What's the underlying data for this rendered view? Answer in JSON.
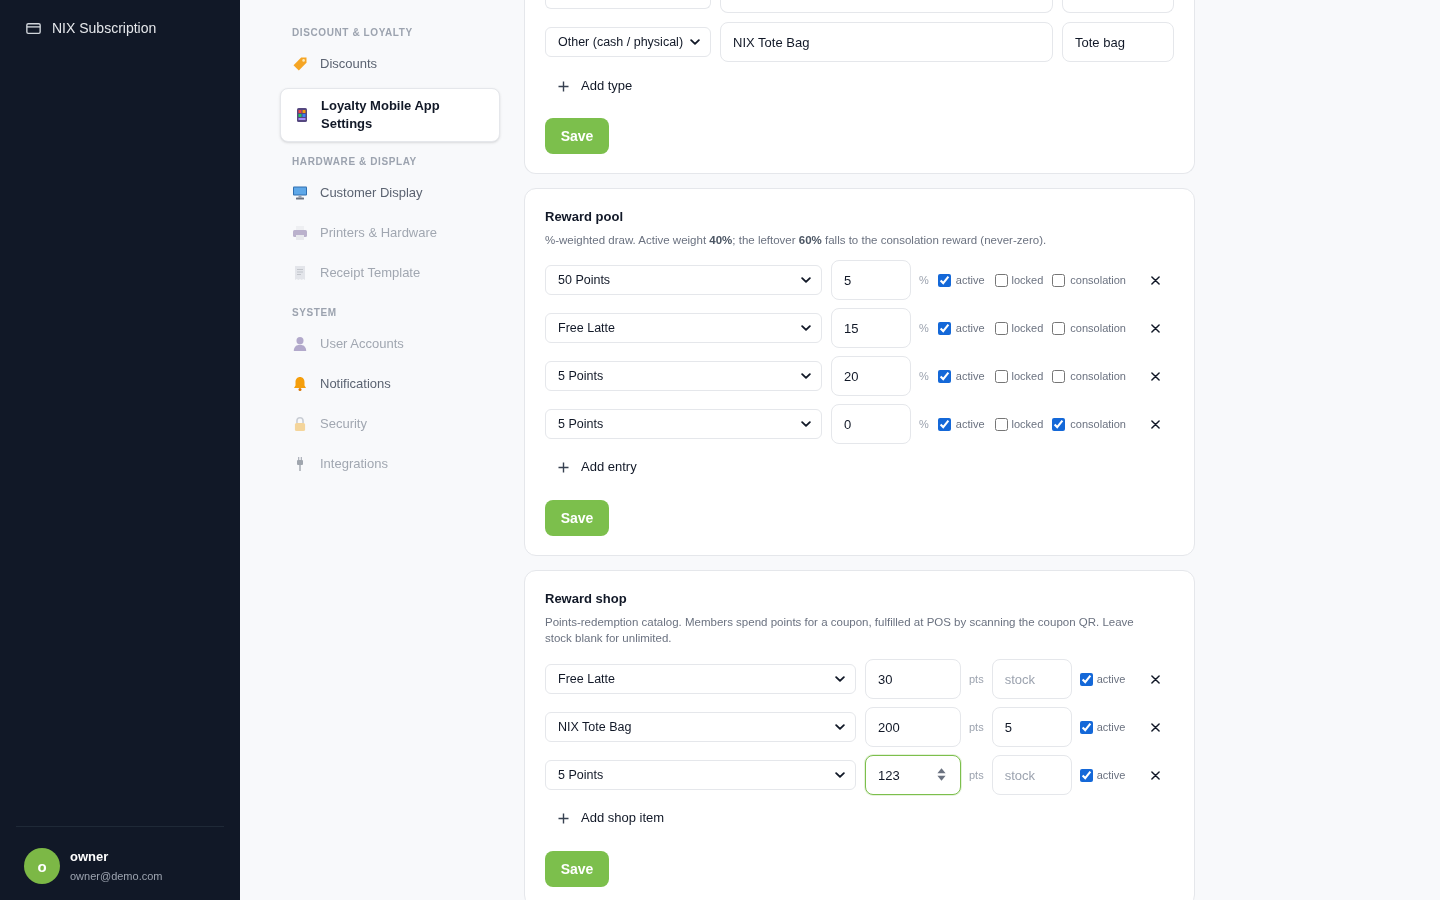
{
  "sidebar": {
    "subscription_link": {
      "label": "NIX Subscription"
    },
    "user": {
      "initial": "o",
      "name": "owner",
      "email": "owner@demo.com"
    }
  },
  "settings_nav": [
    {
      "heading": "DISCOUNT & LOYALTY",
      "items": [
        {
          "label": "Discounts",
          "selected": false,
          "disabled": false
        },
        {
          "label": "Loyalty Mobile App Settings",
          "selected": true,
          "disabled": false
        }
      ]
    },
    {
      "heading": "HARDWARE & DISPLAY",
      "items": [
        {
          "label": "Customer Display",
          "selected": false,
          "disabled": false
        },
        {
          "label": "Printers & Hardware",
          "selected": false,
          "disabled": true
        },
        {
          "label": "Receipt Template",
          "selected": false,
          "disabled": true
        }
      ]
    },
    {
      "heading": "SYSTEM",
      "items": [
        {
          "label": "User Accounts",
          "selected": false,
          "disabled": true
        },
        {
          "label": "Notifications",
          "selected": false,
          "disabled": false
        },
        {
          "label": "Security",
          "selected": false,
          "disabled": true
        },
        {
          "label": "Integrations",
          "selected": false,
          "disabled": true
        }
      ]
    }
  ],
  "reward_types": {
    "rows": [
      {
        "cut_off": true
      },
      {
        "cut_off": false,
        "type": "Other (cash / physical)",
        "name": "NIX Tote Bag",
        "label": "Tote bag"
      }
    ],
    "add_button": "Add type",
    "save_button": "Save"
  },
  "reward_pool": {
    "title": "Reward pool",
    "description": "%-weighted draw. Active weight **40%**; the leftover **60%** falls to the consolation reward (never-zero).",
    "entries": [
      {
        "reward": "50 Points",
        "weight": "5",
        "unit": "%",
        "active": true,
        "active_label": "active",
        "locked": false,
        "locked_label": "locked",
        "consolation": false,
        "consolation_label": "consolation"
      },
      {
        "reward": "Free Latte",
        "weight": "15",
        "unit": "%",
        "active": true,
        "active_label": "active",
        "locked": false,
        "locked_label": "locked",
        "consolation": false,
        "consolation_label": "consolation"
      },
      {
        "reward": "5 Points",
        "weight": "20",
        "unit": "%",
        "active": true,
        "active_label": "active",
        "locked": false,
        "locked_label": "locked",
        "consolation": false,
        "consolation_label": "consolation"
      },
      {
        "reward": "5 Points",
        "weight": "0",
        "unit": "%",
        "active": true,
        "active_label": "active",
        "locked": false,
        "locked_label": "locked",
        "consolation": true,
        "consolation_label": "consolation"
      }
    ],
    "add_button": "Add entry",
    "save_button": "Save"
  },
  "reward_shop": {
    "title": "Reward shop",
    "description": "Points-redemption catalog. Members spend points for a coupon, fulfilled at POS by scanning the coupon QR. Leave stock blank for unlimited.",
    "items": [
      {
        "item": "Free Latte",
        "points": "30",
        "focused": false,
        "unit": "pts",
        "stock": {
          "placeholder": "stock"
        },
        "active": true,
        "active_label": "active"
      },
      {
        "item": "NIX Tote Bag",
        "points": "200",
        "focused": false,
        "unit": "pts",
        "stock": {
          "value": "5"
        },
        "active": true,
        "active_label": "active"
      },
      {
        "item": "5 Points",
        "points": "123",
        "focused": true,
        "unit": "pts",
        "stock": {
          "placeholder": "stock"
        },
        "active": true,
        "active_label": "active"
      }
    ],
    "add_button": "Add shop item",
    "save_button": "Save"
  }
}
